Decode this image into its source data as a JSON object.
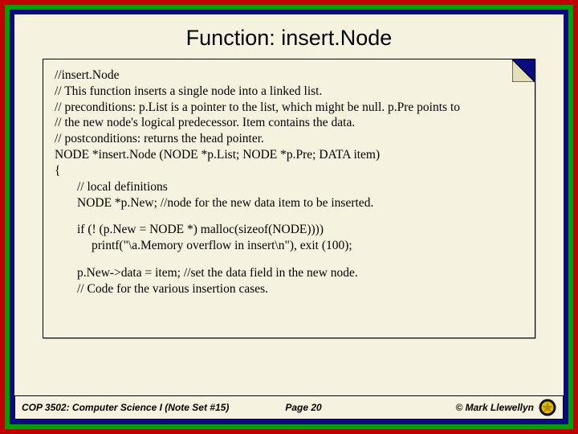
{
  "slide": {
    "title": "Function: insert.Node"
  },
  "code": {
    "l1": "//insert.Node",
    "l2": "//  This function inserts a single node into a linked list.",
    "l3": "//  preconditions:  p.List is a pointer to the list, which might be null.  p.Pre points to",
    "l4": "//                            the new node's logical predecessor.  Item contains the data.",
    "l5": "//  postconditions: returns the head pointer.",
    "l6": "NODE *insert.Node (NODE *p.List;   NODE *p.Pre;    DATA item)",
    "l7": "{",
    "l8": "// local definitions",
    "l9": "NODE *p.New;   //node for the new data item to be inserted.",
    "l10": "if (! (p.New = NODE *) malloc(sizeof(NODE))))",
    "l11": "printf(\"\\a.Memory overflow in insert\\n\"), exit (100);",
    "l12": "p.New->data = item;   //set the data field in the new node.",
    "l13": "// Code for the various insertion cases."
  },
  "footer": {
    "course": "COP 3502: Computer Science I",
    "note": "(Note Set #15)",
    "page": "Page 20",
    "copyright": "© Mark Llewellyn"
  }
}
